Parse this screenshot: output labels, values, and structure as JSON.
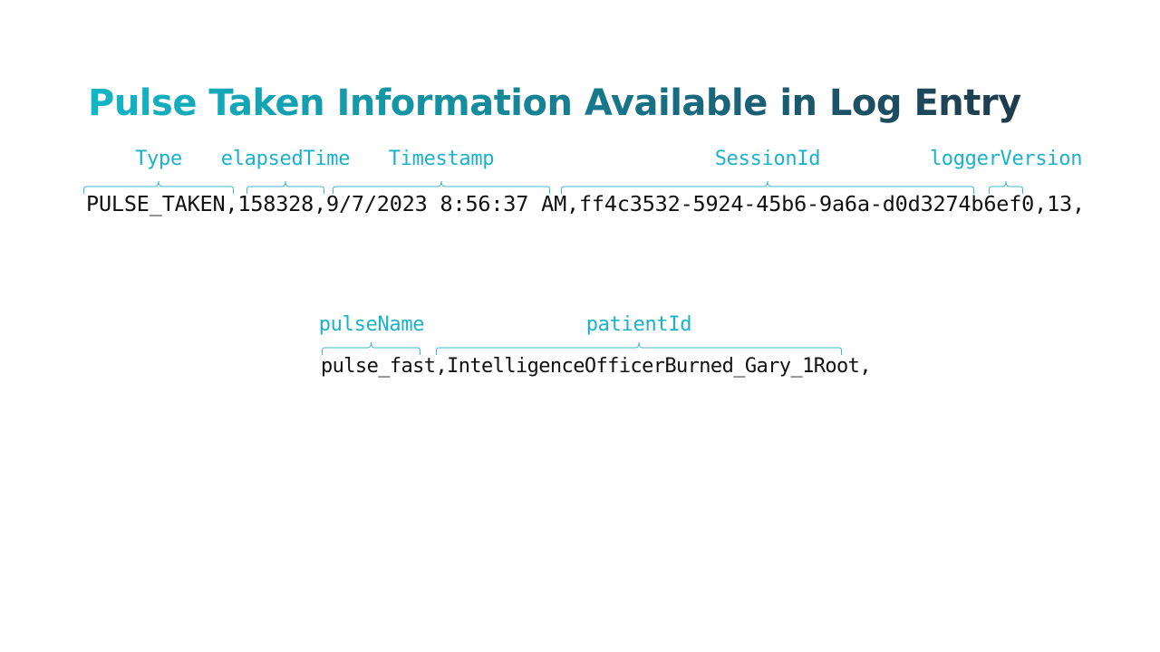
{
  "slide": {
    "title": "Pulse Taken Information Available in Log Entry"
  },
  "log_entry": {
    "line1": "PULSE_TAKEN,158328,9/7/2023 8:56:37 AM,ff4c3532-5924-45b6-9a6a-d0d3274b6ef0,13,",
    "line2": "pulse_fast,IntelligenceOfficerBurned_Gary_1Root,"
  },
  "fields": {
    "type": "Type",
    "elapsed_time": "elapsedTime",
    "timestamp": "Timestamp",
    "session_id": "SessionId",
    "logger_version": "loggerVersion",
    "pulse_name": "pulseName",
    "patient_id": "patientId"
  },
  "colors": {
    "label": "#19b3c9",
    "brace": "#3fb9cc",
    "title_start": "#12b6c6",
    "title_end": "#1f3a4c",
    "log_text": "#111111"
  }
}
